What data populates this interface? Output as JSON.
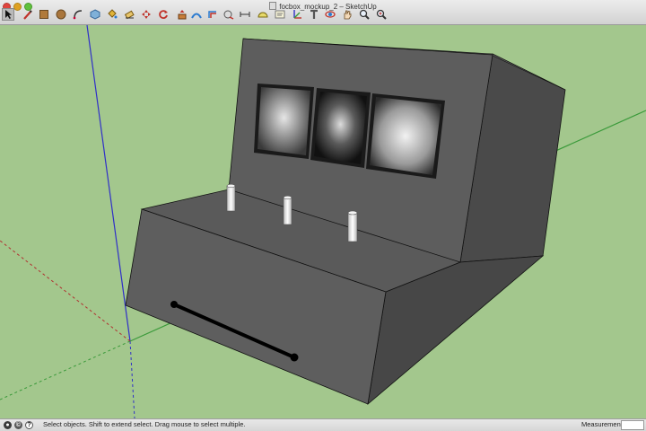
{
  "window": {
    "title": "focbox_mockup_2 – SketchUp"
  },
  "toolbar": {
    "tools": [
      {
        "name": "select",
        "icon": "select-arrow-icon"
      },
      {
        "name": "line",
        "icon": "pencil-icon"
      },
      {
        "name": "rectangle",
        "icon": "rectangle-icon"
      },
      {
        "name": "circle",
        "icon": "circle-icon"
      },
      {
        "name": "arc",
        "icon": "arc-icon"
      },
      {
        "name": "make-component",
        "icon": "component-icon"
      },
      {
        "name": "paint-bucket",
        "icon": "paint-bucket-icon"
      },
      {
        "name": "eraser",
        "icon": "eraser-icon"
      },
      {
        "name": "move",
        "icon": "move-icon"
      },
      {
        "name": "rotate",
        "icon": "rotate-icon"
      },
      {
        "name": "push-pull",
        "icon": "push-pull-icon"
      },
      {
        "name": "follow-me",
        "icon": "follow-me-icon"
      },
      {
        "name": "offset",
        "icon": "offset-icon"
      },
      {
        "name": "tape-measure",
        "icon": "tape-measure-icon"
      },
      {
        "name": "dimension",
        "icon": "dimension-icon"
      },
      {
        "name": "protractor",
        "icon": "protractor-icon"
      },
      {
        "name": "text",
        "icon": "text-icon"
      },
      {
        "name": "axes",
        "icon": "axes-icon"
      },
      {
        "name": "3d-text",
        "icon": "3d-text-icon"
      },
      {
        "name": "orbit",
        "icon": "orbit-icon"
      },
      {
        "name": "pan",
        "icon": "pan-icon"
      },
      {
        "name": "zoom",
        "icon": "zoom-icon"
      },
      {
        "name": "zoom-extents",
        "icon": "zoom-extents-icon"
      }
    ]
  },
  "status": {
    "text": "Select objects. Shift to extend select. Drag mouse to select multiple.",
    "measurements_label": "Measurements",
    "measurements_value": ""
  },
  "colors": {
    "ground": "#a3c78d",
    "model_face": "#5e5e5e",
    "model_face_dark": "#474747",
    "red_axis": "#b03030",
    "green_axis": "#3a9a3a",
    "blue_axis": "#2f2fc8"
  }
}
